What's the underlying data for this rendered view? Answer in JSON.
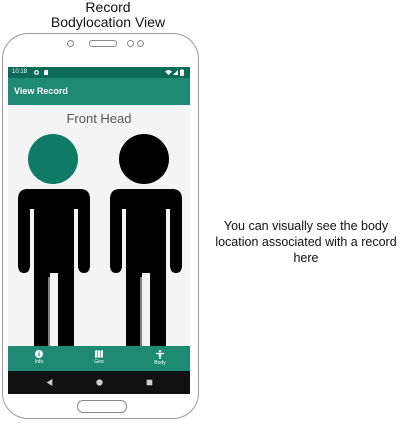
{
  "caption": {
    "line1": "Record",
    "line2": "Bodylocation View"
  },
  "side_note": "You can visually see the body location associated with a record here",
  "status_bar": {
    "time": "10:18"
  },
  "app_bar": {
    "title": "View Record"
  },
  "body_view": {
    "label": "Front Head",
    "highlight_color": "#0f7a66",
    "figure_color": "#000000"
  },
  "bottom_nav": {
    "items": [
      {
        "label": "Info",
        "icon": "info-icon"
      },
      {
        "label": "Geo",
        "icon": "map-icon"
      },
      {
        "label": "Body",
        "icon": "body-icon"
      }
    ]
  },
  "system_nav": {
    "icons": [
      "back-icon",
      "home-icon",
      "recents-icon"
    ]
  },
  "colors": {
    "status_bar": "#0b6a58",
    "app_bar": "#1f8a74",
    "nav_bar": "#111111"
  }
}
